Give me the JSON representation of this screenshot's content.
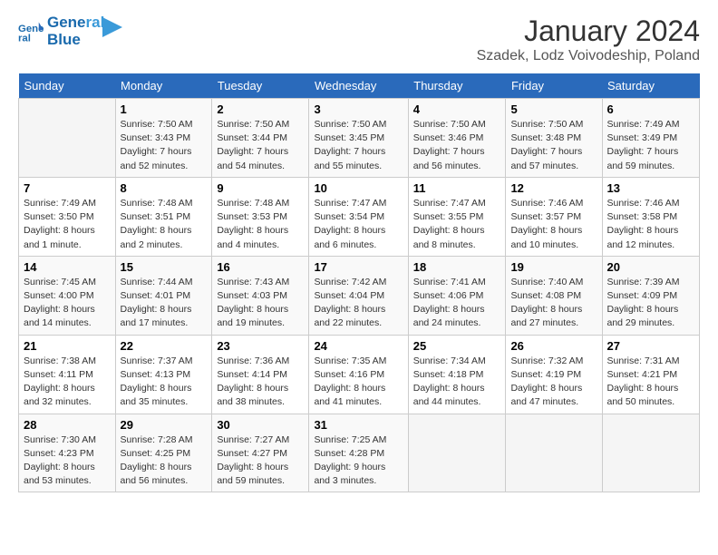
{
  "logo": {
    "line1": "General",
    "line2": "Blue"
  },
  "title": "January 2024",
  "subtitle": "Szadek, Lodz Voivodeship, Poland",
  "days_of_week": [
    "Sunday",
    "Monday",
    "Tuesday",
    "Wednesday",
    "Thursday",
    "Friday",
    "Saturday"
  ],
  "weeks": [
    [
      {
        "day": "",
        "info": ""
      },
      {
        "day": "1",
        "info": "Sunrise: 7:50 AM\nSunset: 3:43 PM\nDaylight: 7 hours\nand 52 minutes."
      },
      {
        "day": "2",
        "info": "Sunrise: 7:50 AM\nSunset: 3:44 PM\nDaylight: 7 hours\nand 54 minutes."
      },
      {
        "day": "3",
        "info": "Sunrise: 7:50 AM\nSunset: 3:45 PM\nDaylight: 7 hours\nand 55 minutes."
      },
      {
        "day": "4",
        "info": "Sunrise: 7:50 AM\nSunset: 3:46 PM\nDaylight: 7 hours\nand 56 minutes."
      },
      {
        "day": "5",
        "info": "Sunrise: 7:50 AM\nSunset: 3:48 PM\nDaylight: 7 hours\nand 57 minutes."
      },
      {
        "day": "6",
        "info": "Sunrise: 7:49 AM\nSunset: 3:49 PM\nDaylight: 7 hours\nand 59 minutes."
      }
    ],
    [
      {
        "day": "7",
        "info": "Sunrise: 7:49 AM\nSunset: 3:50 PM\nDaylight: 8 hours\nand 1 minute."
      },
      {
        "day": "8",
        "info": "Sunrise: 7:48 AM\nSunset: 3:51 PM\nDaylight: 8 hours\nand 2 minutes."
      },
      {
        "day": "9",
        "info": "Sunrise: 7:48 AM\nSunset: 3:53 PM\nDaylight: 8 hours\nand 4 minutes."
      },
      {
        "day": "10",
        "info": "Sunrise: 7:47 AM\nSunset: 3:54 PM\nDaylight: 8 hours\nand 6 minutes."
      },
      {
        "day": "11",
        "info": "Sunrise: 7:47 AM\nSunset: 3:55 PM\nDaylight: 8 hours\nand 8 minutes."
      },
      {
        "day": "12",
        "info": "Sunrise: 7:46 AM\nSunset: 3:57 PM\nDaylight: 8 hours\nand 10 minutes."
      },
      {
        "day": "13",
        "info": "Sunrise: 7:46 AM\nSunset: 3:58 PM\nDaylight: 8 hours\nand 12 minutes."
      }
    ],
    [
      {
        "day": "14",
        "info": "Sunrise: 7:45 AM\nSunset: 4:00 PM\nDaylight: 8 hours\nand 14 minutes."
      },
      {
        "day": "15",
        "info": "Sunrise: 7:44 AM\nSunset: 4:01 PM\nDaylight: 8 hours\nand 17 minutes."
      },
      {
        "day": "16",
        "info": "Sunrise: 7:43 AM\nSunset: 4:03 PM\nDaylight: 8 hours\nand 19 minutes."
      },
      {
        "day": "17",
        "info": "Sunrise: 7:42 AM\nSunset: 4:04 PM\nDaylight: 8 hours\nand 22 minutes."
      },
      {
        "day": "18",
        "info": "Sunrise: 7:41 AM\nSunset: 4:06 PM\nDaylight: 8 hours\nand 24 minutes."
      },
      {
        "day": "19",
        "info": "Sunrise: 7:40 AM\nSunset: 4:08 PM\nDaylight: 8 hours\nand 27 minutes."
      },
      {
        "day": "20",
        "info": "Sunrise: 7:39 AM\nSunset: 4:09 PM\nDaylight: 8 hours\nand 29 minutes."
      }
    ],
    [
      {
        "day": "21",
        "info": "Sunrise: 7:38 AM\nSunset: 4:11 PM\nDaylight: 8 hours\nand 32 minutes."
      },
      {
        "day": "22",
        "info": "Sunrise: 7:37 AM\nSunset: 4:13 PM\nDaylight: 8 hours\nand 35 minutes."
      },
      {
        "day": "23",
        "info": "Sunrise: 7:36 AM\nSunset: 4:14 PM\nDaylight: 8 hours\nand 38 minutes."
      },
      {
        "day": "24",
        "info": "Sunrise: 7:35 AM\nSunset: 4:16 PM\nDaylight: 8 hours\nand 41 minutes."
      },
      {
        "day": "25",
        "info": "Sunrise: 7:34 AM\nSunset: 4:18 PM\nDaylight: 8 hours\nand 44 minutes."
      },
      {
        "day": "26",
        "info": "Sunrise: 7:32 AM\nSunset: 4:19 PM\nDaylight: 8 hours\nand 47 minutes."
      },
      {
        "day": "27",
        "info": "Sunrise: 7:31 AM\nSunset: 4:21 PM\nDaylight: 8 hours\nand 50 minutes."
      }
    ],
    [
      {
        "day": "28",
        "info": "Sunrise: 7:30 AM\nSunset: 4:23 PM\nDaylight: 8 hours\nand 53 minutes."
      },
      {
        "day": "29",
        "info": "Sunrise: 7:28 AM\nSunset: 4:25 PM\nDaylight: 8 hours\nand 56 minutes."
      },
      {
        "day": "30",
        "info": "Sunrise: 7:27 AM\nSunset: 4:27 PM\nDaylight: 8 hours\nand 59 minutes."
      },
      {
        "day": "31",
        "info": "Sunrise: 7:25 AM\nSunset: 4:28 PM\nDaylight: 9 hours\nand 3 minutes."
      },
      {
        "day": "",
        "info": ""
      },
      {
        "day": "",
        "info": ""
      },
      {
        "day": "",
        "info": ""
      }
    ]
  ]
}
